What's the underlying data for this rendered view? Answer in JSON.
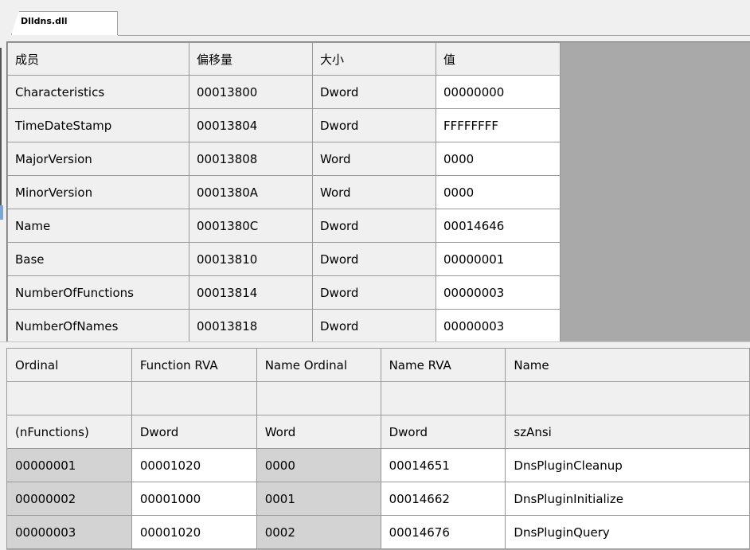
{
  "tab": {
    "label": "Dlldns.dll"
  },
  "export_directory": {
    "headers": [
      "成员",
      "偏移量",
      "大小",
      "值"
    ],
    "rows": [
      [
        "Characteristics",
        "00013800",
        "Dword",
        "00000000"
      ],
      [
        "TimeDateStamp",
        "00013804",
        "Dword",
        "FFFFFFFF"
      ],
      [
        "MajorVersion",
        "00013808",
        "Word",
        "0000"
      ],
      [
        "MinorVersion",
        "0001380A",
        "Word",
        "0000"
      ],
      [
        "Name",
        "0001380C",
        "Dword",
        "00014646"
      ],
      [
        "Base",
        "00013810",
        "Dword",
        "00000001"
      ],
      [
        "NumberOfFunctions",
        "00013814",
        "Dword",
        "00000003"
      ],
      [
        "NumberOfNames",
        "00013818",
        "Dword",
        "00000003"
      ]
    ]
  },
  "functions_table": {
    "headers": [
      "Ordinal",
      "Function RVA",
      "Name Ordinal",
      "Name RVA",
      "Name"
    ],
    "blank_row": [
      "",
      "",
      "",
      "",
      ""
    ],
    "type_row": [
      "(nFunctions)",
      "Dword",
      "Word",
      "Dword",
      "szAnsi"
    ],
    "rows": [
      [
        "00000001",
        "00001020",
        "0000",
        "00014651",
        "DnsPluginCleanup"
      ],
      [
        "00000002",
        "00001000",
        "0001",
        "00014662",
        "DnsPluginInitialize"
      ],
      [
        "00000003",
        "00001020",
        "0002",
        "00014676",
        "DnsPluginQuery"
      ]
    ]
  }
}
